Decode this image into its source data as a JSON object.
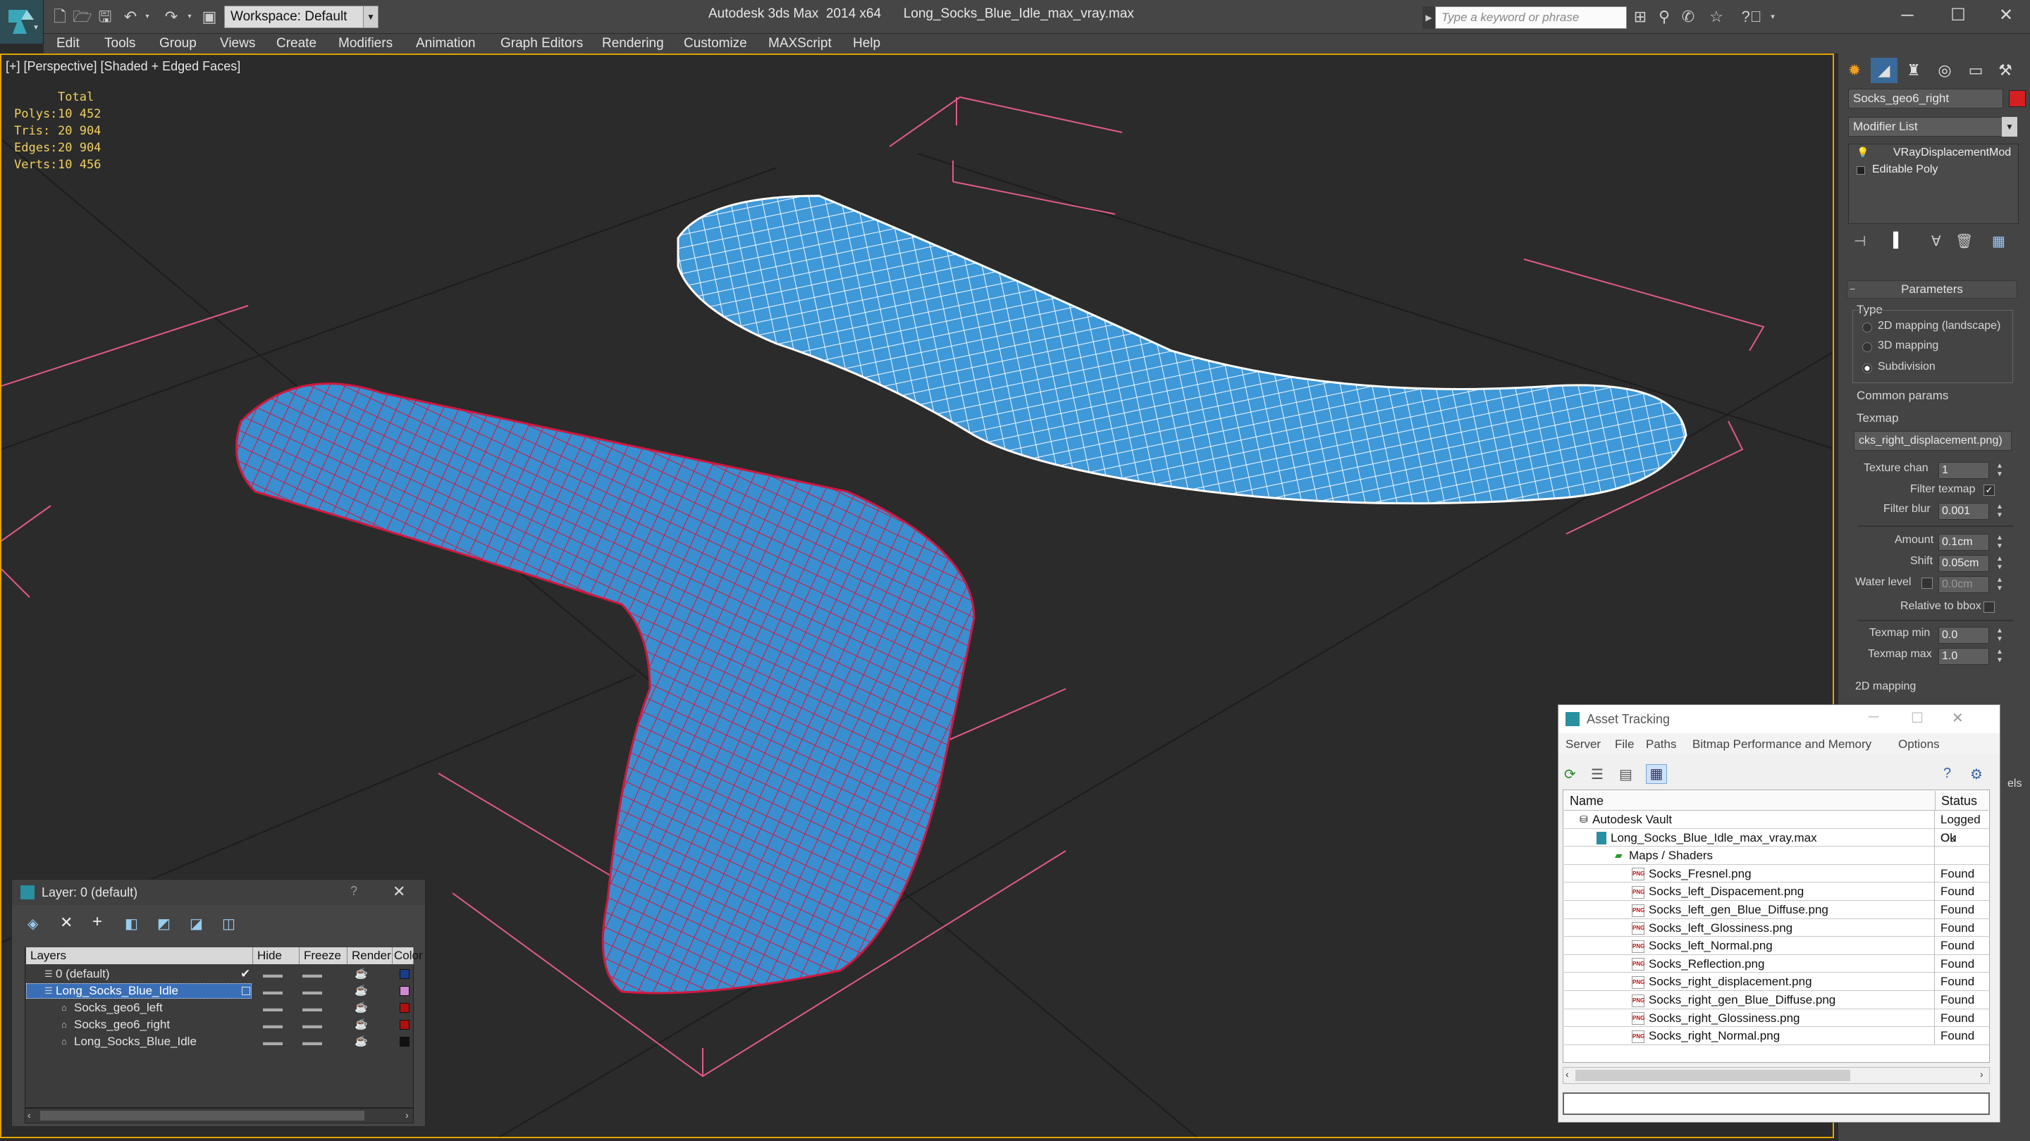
{
  "app": {
    "title": "Autodesk 3ds Max  2014 x64      Long_Socks_Blue_Idle_max_vray.max",
    "workspace": "Workspace: Default",
    "search_placeholder": "Type a keyword or phrase"
  },
  "menu": [
    "Edit",
    "Tools",
    "Group",
    "Views",
    "Create",
    "Modifiers",
    "Animation",
    "Graph Editors",
    "Rendering",
    "Customize",
    "MAXScript",
    "Help"
  ],
  "viewport": {
    "label": "[+] [Perspective] [Shaded + Edged Faces]",
    "stats": {
      "header": "Total",
      "rows": [
        {
          "label": "Polys:",
          "value": "10 452"
        },
        {
          "label": "Tris:",
          "value": "20 904"
        },
        {
          "label": "Edges:",
          "value": "20 904"
        },
        {
          "label": "Verts:",
          "value": "10 456"
        }
      ]
    }
  },
  "command_panel": {
    "object_name": "Socks_geo6_right",
    "object_color": "#d42020",
    "modifier_list": "Modifier List",
    "stack": [
      "VRayDisplacementMod",
      "Editable Poly"
    ],
    "parameters_title": "Parameters",
    "type_label": "Type",
    "type_options": [
      {
        "label": "2D mapping (landscape)",
        "selected": false
      },
      {
        "label": "3D mapping",
        "selected": false
      },
      {
        "label": "Subdivision",
        "selected": true
      }
    ],
    "common_params": "Common params",
    "texmap_label": "Texmap",
    "texmap_value": "cks_right_displacement.png)",
    "texture_chan_label": "Texture chan",
    "texture_chan": "1",
    "filter_texmap_label": "Filter texmap",
    "filter_blur_label": "Filter blur",
    "filter_blur": "0.001",
    "amount_label": "Amount",
    "amount": "0.1cm",
    "shift_label": "Shift",
    "shift": "0.05cm",
    "water_level_label": "Water level",
    "water_level": "0.0cm",
    "relative_bbox_label": "Relative to bbox",
    "texmap_min_label": "Texmap min",
    "texmap_min": "0.0",
    "texmap_max_label": "Texmap max",
    "texmap_max": "1.0",
    "mapping_2d": "2D mapping"
  },
  "layer_dialog": {
    "title": "Layer: 0 (default)",
    "help": "?",
    "columns": [
      "Layers",
      "Hide",
      "Freeze",
      "Render",
      "Color"
    ],
    "rows": [
      {
        "name": "0 (default)",
        "color": "#1a3d8a"
      },
      {
        "name": "Long_Socks_Blue_Idle",
        "color": "#d08ad0"
      },
      {
        "name": "Socks_geo6_left",
        "color": "#b01010"
      },
      {
        "name": "Socks_geo6_right",
        "color": "#b01010"
      },
      {
        "name": "Long_Socks_Blue_Idle",
        "color": "#111111"
      }
    ]
  },
  "asset_tracking": {
    "title": "Asset Tracking",
    "menu": [
      "Server",
      "File",
      "Paths",
      "Bitmap Performance and Memory",
      "Options"
    ],
    "columns": [
      "Name",
      "Status"
    ],
    "rows": [
      {
        "name": "Autodesk Vault",
        "status": "Logged Ou"
      },
      {
        "name": "Long_Socks_Blue_Idle_max_vray.max",
        "status": "Ok"
      },
      {
        "name": "Maps / Shaders",
        "status": ""
      },
      {
        "name": "Socks_Fresnel.png",
        "status": "Found"
      },
      {
        "name": "Socks_left_Dispacement.png",
        "status": "Found"
      },
      {
        "name": "Socks_left_gen_Blue_Diffuse.png",
        "status": "Found"
      },
      {
        "name": "Socks_left_Glossiness.png",
        "status": "Found"
      },
      {
        "name": "Socks_left_Normal.png",
        "status": "Found"
      },
      {
        "name": "Socks_Reflection.png",
        "status": "Found"
      },
      {
        "name": "Socks_right_displacement.png",
        "status": "Found"
      },
      {
        "name": "Socks_right_gen_Blue_Diffuse.png",
        "status": "Found"
      },
      {
        "name": "Socks_right_Glossiness.png",
        "status": "Found"
      },
      {
        "name": "Socks_right_Normal.png",
        "status": "Found"
      }
    ],
    "side_text": "els"
  }
}
